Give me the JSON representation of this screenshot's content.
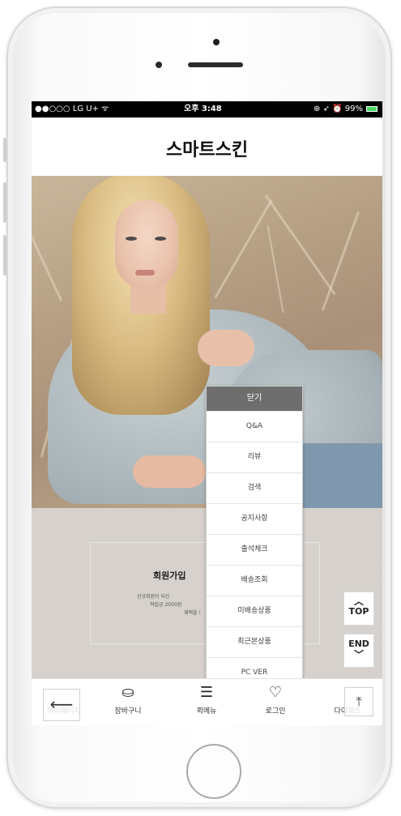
{
  "status_bar": {
    "carrier": "●●○○○ LG U+ ᯤ",
    "time": "오후 3:48",
    "right": "⊕ ➶ ⏰ 99%"
  },
  "app": {
    "title": "스마트스킨"
  },
  "banner": {
    "title": "회원가입",
    "line1": "신규회원이 되신",
    "line2": "적립금 2000원",
    "line3": "혜택을 !"
  },
  "menu": {
    "close_label": "닫기",
    "items": [
      {
        "label": "Q&A"
      },
      {
        "label": "리뷰"
      },
      {
        "label": "검색"
      },
      {
        "label": "공지사항"
      },
      {
        "label": "출석체크"
      },
      {
        "label": "배송조회"
      },
      {
        "label": "미배송상품"
      },
      {
        "label": "최근본상품"
      },
      {
        "label": "PC VER"
      }
    ]
  },
  "scroll_buttons": {
    "top": "TOP",
    "end": "END"
  },
  "bottom_nav": {
    "items": [
      {
        "label": "마이페이지",
        "icon": "person-icon"
      },
      {
        "label": "장바구니",
        "icon": "bag-icon"
      },
      {
        "label": "퀵메뉴",
        "icon": "menu-icon"
      },
      {
        "label": "로그인",
        "icon": "heart-icon"
      },
      {
        "label": "다이렉트",
        "icon": "arrow-up-icon"
      }
    ]
  },
  "colors": {
    "menu_header": "#6e6e6e",
    "banner_bg": "#d6d1cc",
    "status_bar": "#000000"
  }
}
